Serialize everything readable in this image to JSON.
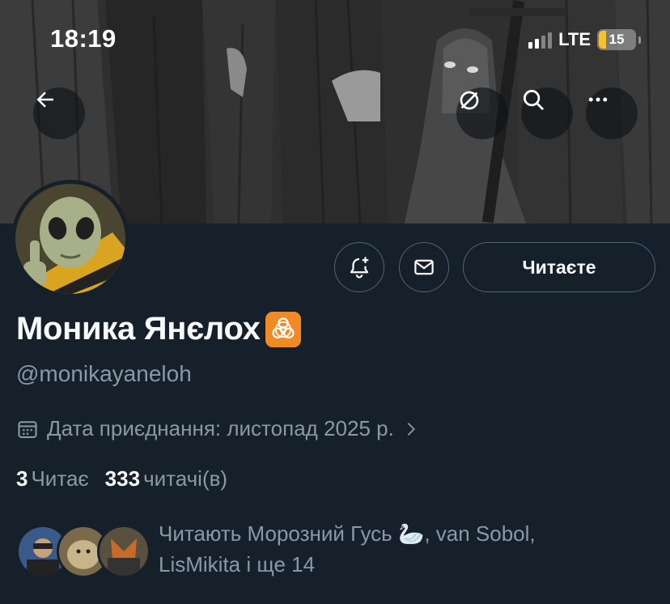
{
  "status_bar": {
    "time": "18:19",
    "network": "LTE",
    "battery": "15"
  },
  "banner": {
    "description_icon": "banner-image"
  },
  "header_actions": {
    "back_icon": "arrow-left-icon",
    "grok_icon": "slash-circle-icon",
    "search_icon": "search-icon",
    "more_icon": "more-icon"
  },
  "profile": {
    "display_name": "Моника Янєлох",
    "name_emoji_icon": "biohazard-icon",
    "handle": "@monikayaneloh",
    "joined": "Дата приєднання: листопад 2025 р.",
    "following_count": "3",
    "following_label": "Читає",
    "followers_count": "333",
    "followers_label": "читачі(в)",
    "followed_by_text_1": "Читають Морозний Гусь ",
    "followed_by_emoji": "🦢",
    "followed_by_text_2": ", van Sobol,",
    "followed_by_text_3": "LisMikita і ще 14"
  },
  "actions": {
    "notify_icon": "bell-plus-icon",
    "message_icon": "mail-icon",
    "follow_label": "Читаєте"
  },
  "colors": {
    "background": "#15202b",
    "text_primary": "#f7f9f9",
    "text_secondary": "#8b98a5",
    "border": "#536471",
    "accent_emoji": "#f08a24"
  }
}
